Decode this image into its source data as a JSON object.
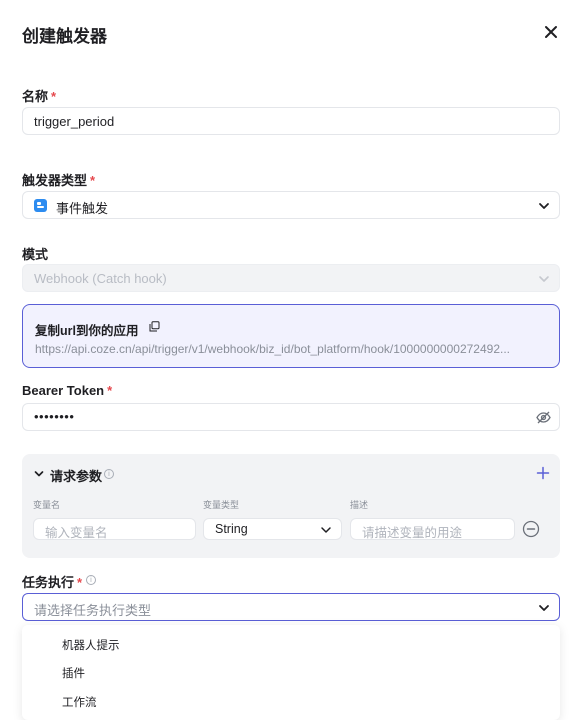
{
  "dialog": {
    "title": "创建触发器"
  },
  "form": {
    "name": {
      "label": "名称",
      "required": "*",
      "value": "trigger_period"
    },
    "trigger_type": {
      "label": "触发器类型",
      "required": "*",
      "value": "事件触发",
      "icon": "event-trigger-icon"
    },
    "mode": {
      "label": "模式",
      "value": "Webhook (Catch hook)",
      "disabled": true
    },
    "webhook": {
      "title": "复制url到你的应用",
      "url": "https://api.coze.cn/api/trigger/v1/webhook/biz_id/bot_platform/hook/1000000000272492..."
    },
    "bearer_token": {
      "label": "Bearer Token",
      "required": "*",
      "value": "••••••••"
    },
    "request_params": {
      "title": "请求参数",
      "columns": {
        "name": "变量名",
        "type": "变量类型",
        "desc": "描述"
      },
      "row": {
        "name_placeholder": "输入变量名",
        "type_value": "String",
        "desc_placeholder": "请描述变量的用途"
      }
    },
    "task": {
      "label": "任务执行",
      "required": "*",
      "placeholder": "请选择任务执行类型",
      "options": [
        "机器人提示",
        "插件",
        "工作流"
      ]
    }
  },
  "colors": {
    "accent": "#5a5fd6",
    "required": "#e5484d",
    "event_icon": "#2d8cf0"
  }
}
